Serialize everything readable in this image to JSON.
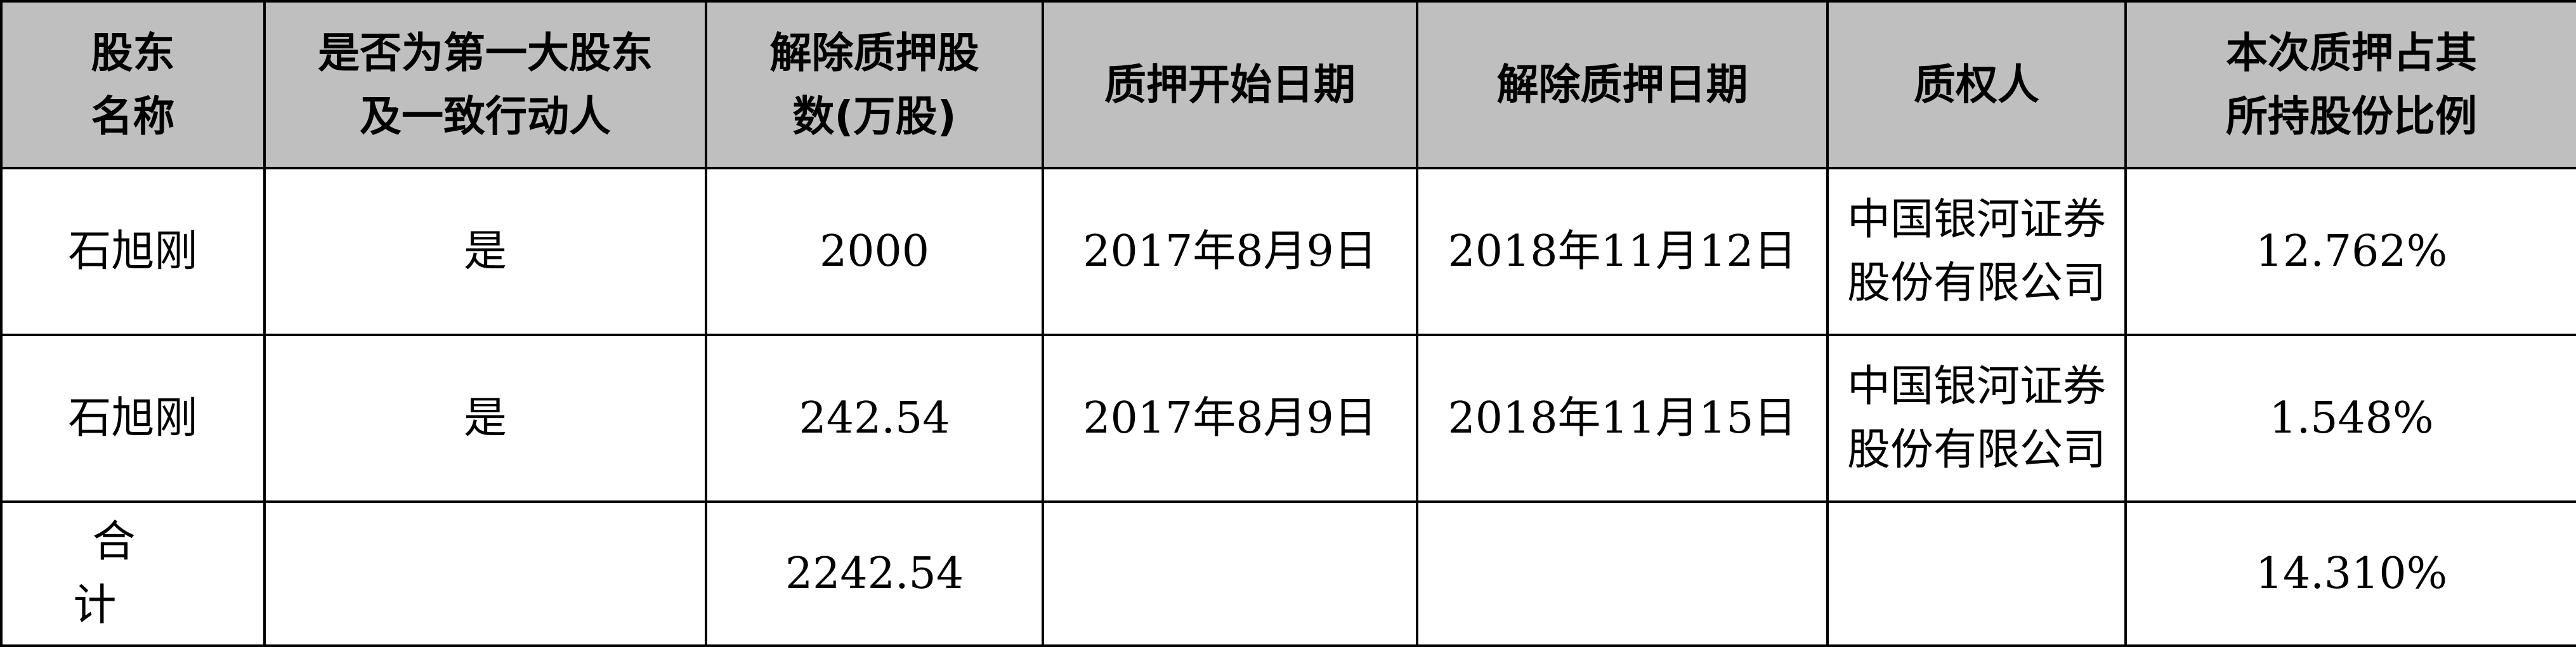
{
  "table": {
    "headers": [
      [
        "股东",
        "名称"
      ],
      [
        "是否为第一大股东",
        "及一致行动人"
      ],
      [
        "解除质押股",
        "数(万股)"
      ],
      [
        "质押开始日期"
      ],
      [
        "解除质押日期"
      ],
      [
        "质权人"
      ],
      [
        "本次质押占其",
        "所持股份比例"
      ]
    ],
    "rows": [
      {
        "shareholder": "石旭刚",
        "is_largest": "是",
        "shares": "2000",
        "start_date": "2017年8月9日",
        "release_date": "2018年11月12日",
        "pledgee": [
          "中国银河证券",
          "股份有限公司"
        ],
        "ratio": "12.762%"
      },
      {
        "shareholder": "石旭刚",
        "is_largest": "是",
        "shares": "242.54",
        "start_date": "2017年8月9日",
        "release_date": "2018年11月15日",
        "pledgee": [
          "中国银河证券",
          "股份有限公司"
        ],
        "ratio": "1.548%"
      }
    ],
    "total": {
      "label": "合计",
      "shares": "2242.54",
      "ratio": "14.310%"
    }
  }
}
